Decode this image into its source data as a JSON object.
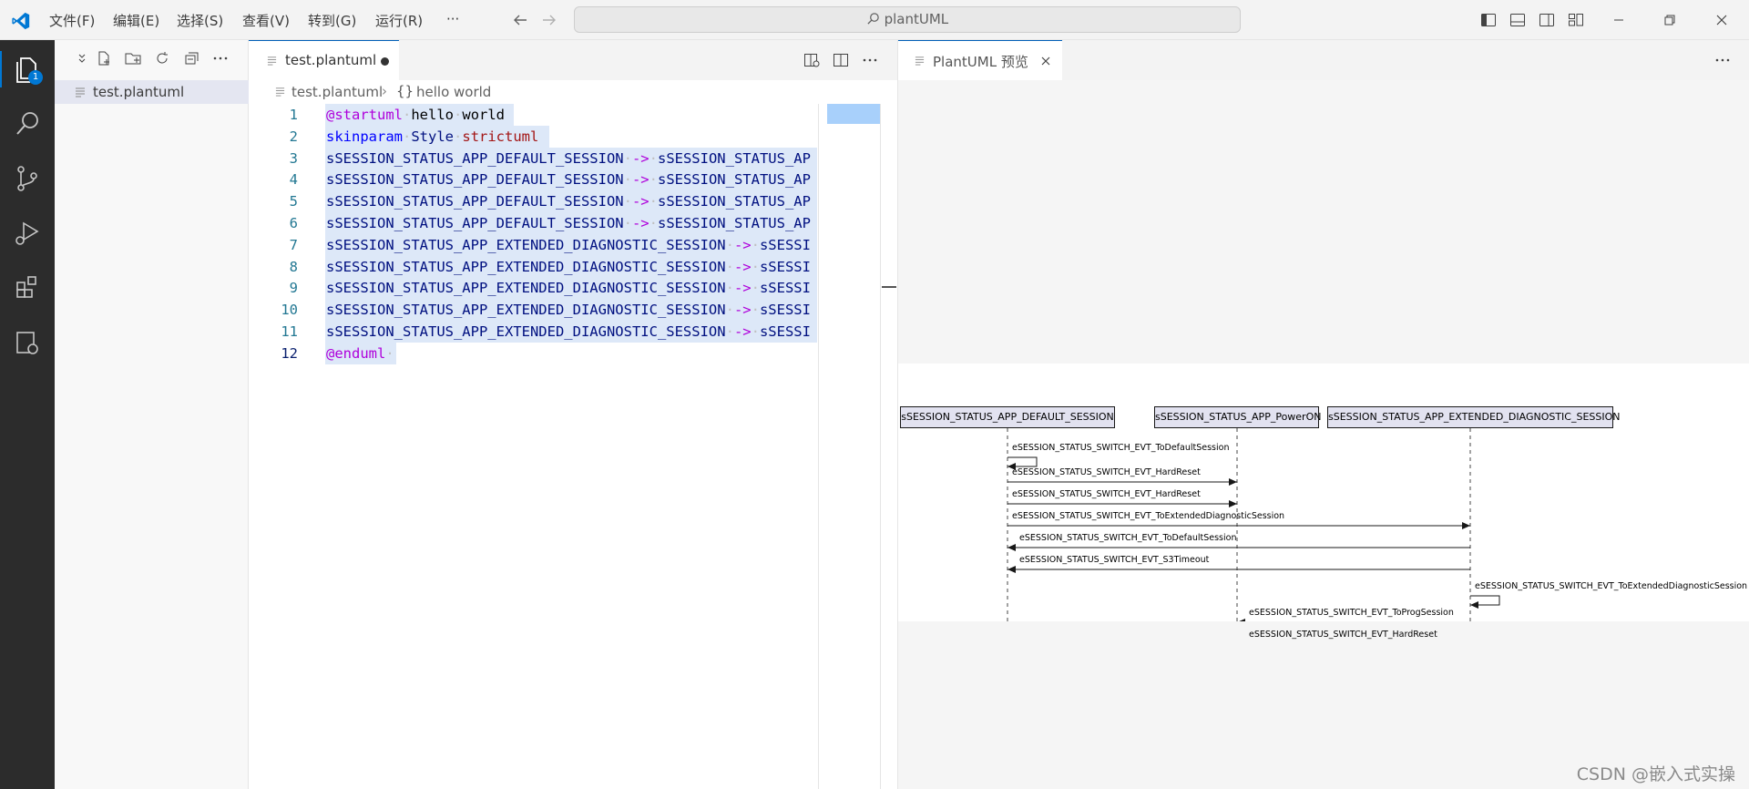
{
  "titlebar": {
    "menus": [
      "文件(F)",
      "编辑(E)",
      "选择(S)",
      "查看(V)",
      "转到(G)",
      "运行(R)",
      "···"
    ],
    "search_text": "plantUML"
  },
  "activitybar": {
    "badge": "1"
  },
  "sidebar": {
    "file": "test.plantuml"
  },
  "editor": {
    "tab_label": "test.plantuml",
    "breadcrumb_file": "test.plantuml",
    "breadcrumb_symbol": "hello world",
    "lines": [
      {
        "n": "1",
        "parts": [
          [
            "kw",
            "@startuml"
          ],
          [
            "dot",
            "·"
          ],
          [
            "plain",
            "hello"
          ],
          [
            "dot",
            "·"
          ],
          [
            "plain",
            "world"
          ]
        ]
      },
      {
        "n": "2",
        "parts": [
          [
            "kw2",
            "skinparam"
          ],
          [
            "dot",
            "·"
          ],
          [
            "ident",
            "Style"
          ],
          [
            "dot",
            "·"
          ],
          [
            "str",
            "strictuml"
          ]
        ]
      },
      {
        "n": "3",
        "parts": [
          [
            "ident",
            "sSESSION_STATUS_APP_DEFAULT_SESSION"
          ],
          [
            "dot",
            "·"
          ],
          [
            "op",
            "->"
          ],
          [
            "dot",
            "·"
          ],
          [
            "ident",
            "sSESSION_STATUS_AP"
          ]
        ]
      },
      {
        "n": "4",
        "parts": [
          [
            "ident",
            "sSESSION_STATUS_APP_DEFAULT_SESSION"
          ],
          [
            "dot",
            "·"
          ],
          [
            "op",
            "->"
          ],
          [
            "dot",
            "·"
          ],
          [
            "ident",
            "sSESSION_STATUS_AP"
          ]
        ]
      },
      {
        "n": "5",
        "parts": [
          [
            "ident",
            "sSESSION_STATUS_APP_DEFAULT_SESSION"
          ],
          [
            "dot",
            "·"
          ],
          [
            "op",
            "->"
          ],
          [
            "dot",
            "·"
          ],
          [
            "ident",
            "sSESSION_STATUS_AP"
          ]
        ]
      },
      {
        "n": "6",
        "parts": [
          [
            "ident",
            "sSESSION_STATUS_APP_DEFAULT_SESSION"
          ],
          [
            "dot",
            "·"
          ],
          [
            "op",
            "->"
          ],
          [
            "dot",
            "·"
          ],
          [
            "ident",
            "sSESSION_STATUS_AP"
          ]
        ]
      },
      {
        "n": "7",
        "parts": [
          [
            "ident",
            "sSESSION_STATUS_APP_EXTENDED_DIAGNOSTIC_SESSION"
          ],
          [
            "dot",
            "·"
          ],
          [
            "op",
            "->"
          ],
          [
            "dot",
            "·"
          ],
          [
            "ident",
            "sSESSI"
          ]
        ]
      },
      {
        "n": "8",
        "parts": [
          [
            "ident",
            "sSESSION_STATUS_APP_EXTENDED_DIAGNOSTIC_SESSION"
          ],
          [
            "dot",
            "·"
          ],
          [
            "op",
            "->"
          ],
          [
            "dot",
            "·"
          ],
          [
            "ident",
            "sSESSI"
          ]
        ]
      },
      {
        "n": "9",
        "parts": [
          [
            "ident",
            "sSESSION_STATUS_APP_EXTENDED_DIAGNOSTIC_SESSION"
          ],
          [
            "dot",
            "·"
          ],
          [
            "op",
            "->"
          ],
          [
            "dot",
            "·"
          ],
          [
            "ident",
            "sSESSI"
          ]
        ]
      },
      {
        "n": "10",
        "parts": [
          [
            "ident",
            "sSESSION_STATUS_APP_EXTENDED_DIAGNOSTIC_SESSION"
          ],
          [
            "dot",
            "·"
          ],
          [
            "op",
            "->"
          ],
          [
            "dot",
            "·"
          ],
          [
            "ident",
            "sSESSI"
          ]
        ]
      },
      {
        "n": "11",
        "parts": [
          [
            "ident",
            "sSESSION_STATUS_APP_EXTENDED_DIAGNOSTIC_SESSION"
          ],
          [
            "dot",
            "·"
          ],
          [
            "op",
            "->"
          ],
          [
            "dot",
            "·"
          ],
          [
            "ident",
            "sSESSI"
          ]
        ]
      },
      {
        "n": "12",
        "parts": [
          [
            "kw",
            "@enduml"
          ],
          [
            "dot",
            "·"
          ]
        ]
      }
    ]
  },
  "preview": {
    "tab_label": "PlantUML 预览",
    "participants": [
      "sSESSION_STATUS_APP_DEFAULT_SESSION",
      "sSESSION_STATUS_APP_PowerON",
      "sSESSION_STATUS_APP_EXTENDED_DIAGNOSTIC_SESSION"
    ],
    "messages": [
      {
        "label": "eSESSION_STATUS_SWITCH_EVT_ToDefaultSession",
        "from": 0,
        "to": 0
      },
      {
        "label": "eSESSION_STATUS_SWITCH_EVT_HardReset",
        "from": 0,
        "to": 1
      },
      {
        "label": "eSESSION_STATUS_SWITCH_EVT_HardReset",
        "from": 0,
        "to": 1
      },
      {
        "label": "eSESSION_STATUS_SWITCH_EVT_ToExtendedDiagnosticSession",
        "from": 0,
        "to": 2
      },
      {
        "label": "eSESSION_STATUS_SWITCH_EVT_ToDefaultSession",
        "from": 2,
        "to": 0
      },
      {
        "label": "eSESSION_STATUS_SWITCH_EVT_S3Timeout",
        "from": 2,
        "to": 0
      },
      {
        "label": "eSESSION_STATUS_SWITCH_EVT_ToExtendedDiagnosticSession",
        "from": 2,
        "to": 2
      },
      {
        "label": "eSESSION_STATUS_SWITCH_EVT_ToProgSession",
        "from": 2,
        "to": 1
      },
      {
        "label": "eSESSION_STATUS_SWITCH_EVT_HardReset",
        "from": 2,
        "to": 1
      }
    ]
  },
  "watermark": "CSDN @嵌入式实操"
}
